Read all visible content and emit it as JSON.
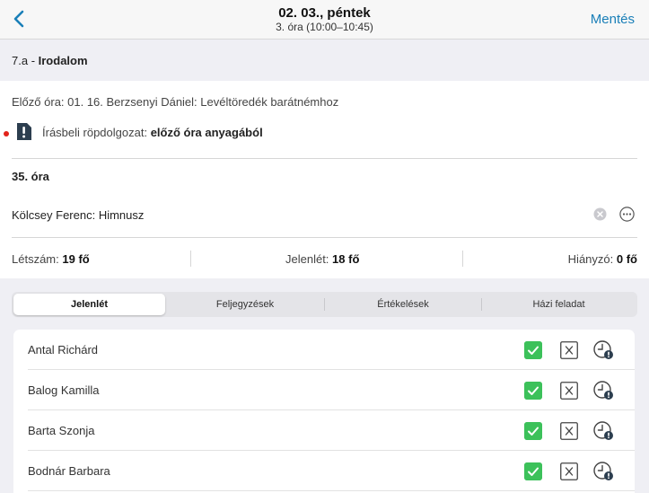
{
  "nav": {
    "title": "02. 03., péntek",
    "subtitle": "3. óra (10:00–10:45)",
    "save_label": "Mentés"
  },
  "class": {
    "group": "7.a",
    "separator": " - ",
    "subject": "Irodalom"
  },
  "info": {
    "previous_lesson": "Előző óra: 01. 16. Berzsenyi Dániel: Levéltöredék barátnémhoz",
    "exam_label": "Írásbeli röpdolgozat:",
    "exam_value": "előző óra anyagából",
    "lesson_number": "35. óra",
    "topic": "Kölcsey Ferenc: Himnusz"
  },
  "stats": {
    "enrolled_label": "Létszám:",
    "enrolled_value": "19 fő",
    "present_label": "Jelenlét:",
    "present_value": "18 fő",
    "absent_label": "Hiányzó:",
    "absent_value": "0 fő"
  },
  "tabs": [
    {
      "label": "Jelenlét",
      "active": true
    },
    {
      "label": "Feljegyzések",
      "active": false
    },
    {
      "label": "Értékelések",
      "active": false
    },
    {
      "label": "Házi feladat",
      "active": false
    }
  ],
  "students": [
    {
      "name": "Antal Richárd",
      "present": true
    },
    {
      "name": "Balog Kamilla",
      "present": true
    },
    {
      "name": "Barta Szonja",
      "present": true
    },
    {
      "name": "Bodnár Barbara",
      "present": true
    }
  ],
  "colors": {
    "accent": "#1a7fb8",
    "present_green": "#3cc15a",
    "alert_red": "#e2231a"
  }
}
